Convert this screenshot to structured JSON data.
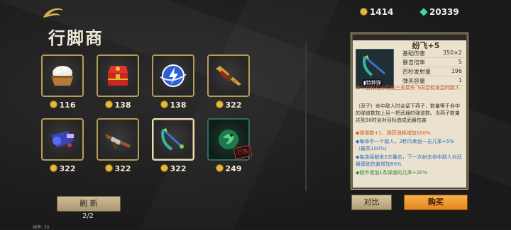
{
  "header": {
    "title": "行脚商",
    "logo_icon": "swirl-logo-icon"
  },
  "currency": {
    "coins": "1414",
    "gems": "20339"
  },
  "items": [
    {
      "name": "rice-bowl",
      "price": "116",
      "selected": false
    },
    {
      "name": "red-treasure-chest",
      "price": "138",
      "selected": false
    },
    {
      "name": "blue-lightning-orb",
      "price": "138",
      "selected": false
    },
    {
      "name": "golden-rifle",
      "price": "322",
      "selected": false
    },
    {
      "name": "blue-cannon",
      "price": "322",
      "selected": false
    },
    {
      "name": "brown-shotgun",
      "price": "322",
      "selected": false
    },
    {
      "name": "green-crossbow",
      "price": "322",
      "selected": true
    },
    {
      "name": "green-dragon-orb",
      "price": "249",
      "selected": false,
      "stamp": "已售"
    }
  ],
  "refresh": {
    "label": "刷 新",
    "count": "2/2"
  },
  "fps_label": "帧率: 30",
  "detail": {
    "name": "纷飞+5",
    "weapon_tag": "▮特种弹",
    "stats": [
      {
        "key": "基础伤害",
        "value": "350×2"
      },
      {
        "key": "暴击倍率",
        "value": "5"
      },
      {
        "key": "百秒发射量",
        "value": "196"
      },
      {
        "key": "弹夹容量",
        "value": "1"
      }
    ],
    "red_text": "命中目标后分裂出三支箭矢飞向目标身后的敌人",
    "desc": "（双子）命中敌人时会留下燕子，数量等于命中的弹道数加上另一把武器的弹道数。当燕子数量达到30时会对目标造成武器伤害",
    "effects": [
      {
        "text": "◆弹道数+1，弹药消耗增加100%",
        "color": "orange"
      },
      {
        "text": "◆每命中一个敌人，3秒内幸运一击几率+5%（最高100%）",
        "color": "blue"
      },
      {
        "text": "◆每连续触发2次暴击，下一次射击命中敌人对武器基础伤害增加80%",
        "color": "blue"
      },
      {
        "text": "◆额外增加1条弹道的几率+20%",
        "color": "green"
      }
    ]
  },
  "buttons": {
    "compare": "对比",
    "buy": "购买"
  }
}
